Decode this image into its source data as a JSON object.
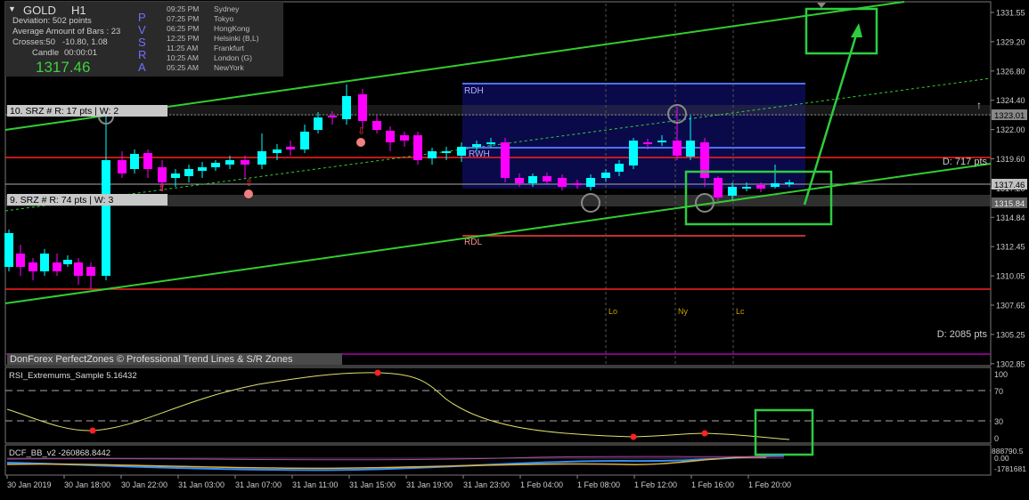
{
  "symbol": {
    "name": "GOLD",
    "timeframe": "H1",
    "price": "1317.46"
  },
  "info": {
    "deviation": "Deviation: 502 points",
    "avg_bars": "Average Amount of Bars : 23",
    "crosses": "Crosses:50",
    "crosses_vals": "-10.80, 1.08",
    "candle_label": "Candle",
    "candle_time": "00:00:01",
    "pvsra_letters": [
      "P",
      "V",
      "S",
      "R",
      "A"
    ]
  },
  "sessions": [
    {
      "time": "09:25 PM",
      "city": "Sydney"
    },
    {
      "time": "07:25 PM",
      "city": "Tokyo"
    },
    {
      "time": "06:25 PM",
      "city": "HongKong"
    },
    {
      "time": "12:25 PM",
      "city": "Helsinki  (B,L)"
    },
    {
      "time": "11:25 AM",
      "city": "Frankfurt"
    },
    {
      "time": "10:25 AM",
      "city": "London  (G)"
    },
    {
      "time": "05:25 AM",
      "city": "NewYork"
    }
  ],
  "zones": {
    "srz_top": "10. SRZ # R: 17 pts | W: 2",
    "srz_bottom": "9. SRZ # R: 74 pts | W: 3",
    "rdh": "RDH",
    "rdl": "RDL",
    "rwh": "RWH",
    "d_top": "D: 717 pts",
    "d_bottom": "D: 2085 pts",
    "session_markers": [
      "Lo",
      "Ny",
      "Lc"
    ],
    "watermark": "DonForex PerfectZones © Professional Trend Lines & S/R Zones"
  },
  "price_axis": {
    "ticks": [
      "1331.55",
      "1329.20",
      "1326.80",
      "1324.40",
      "1322.00",
      "1319.60",
      "1317.20",
      "1314.84",
      "1312.45",
      "1310.05",
      "1307.65",
      "1305.25",
      "1302.85"
    ],
    "highlight_upper": "1323.01",
    "highlight_current": "1317.46",
    "highlight_lower": "1315.84",
    "colors": {
      "upper": "#888888",
      "current": "#c0c0c0",
      "lower": "#606060"
    }
  },
  "rsi": {
    "title": "RSI_Extremums_Sample 5.16432",
    "levels": [
      "100",
      "70",
      "30",
      "0"
    ]
  },
  "dcf": {
    "title": "DCF_BB_v2 -260868.8442",
    "levels": [
      "888790.5",
      "0.00",
      "-1781681"
    ]
  },
  "time_axis": [
    "30 Jan 2019",
    "30 Jan 18:00",
    "30 Jan 22:00",
    "31 Jan 03:00",
    "31 Jan 07:00",
    "31 Jan 11:00",
    "31 Jan 15:00",
    "31 Jan 19:00",
    "31 Jan 23:00",
    "1 Feb 04:00",
    "1 Feb 08:00",
    "1 Feb 12:00",
    "1 Feb 16:00",
    "1 Feb 20:00"
  ],
  "colors": {
    "bull": "#00ffff",
    "bear": "#ff00ff",
    "trend": "#32cd32",
    "box": "#2ecc40",
    "red_line": "#ff2020",
    "zone_fill": "#0a0a4a"
  }
}
